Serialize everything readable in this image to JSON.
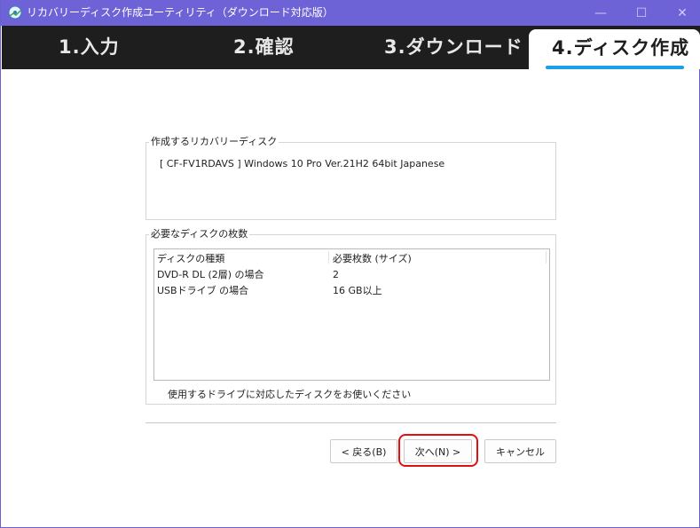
{
  "window": {
    "title": "リカバリーディスク作成ユーティリティ（ダウンロード対応版）",
    "min_glyph": "—",
    "max_glyph": "☐",
    "close_glyph": "✕",
    "title_color": "#6d63d6"
  },
  "steps": [
    {
      "label": "1.入力"
    },
    {
      "label": "2.確認"
    },
    {
      "label": "3.ダウンロード"
    },
    {
      "label": "4.ディスク作成",
      "active": true
    }
  ],
  "recovery_disk": {
    "legend": "作成するリカバリーディスク",
    "value": "[ CF-FV1RDAVS ] Windows 10 Pro Ver.21H2 64bit Japanese"
  },
  "required_disks": {
    "legend": "必要なディスクの枚数",
    "columns": [
      "ディスクの種類",
      "必要枚数 (サイズ)"
    ],
    "rows": [
      [
        "DVD-R DL (2層) の場合",
        "2"
      ],
      [
        "USBドライブ の場合",
        "16 GB以上"
      ]
    ],
    "note": "使用するドライブに対応したディスクをお使いください"
  },
  "buttons": {
    "back": "< 戻る(B)",
    "next": "次へ(N) >",
    "cancel": "キャンセル"
  },
  "accent_colors": {
    "active_step_underline": "#1aa0e8",
    "highlight": "#e01010"
  }
}
